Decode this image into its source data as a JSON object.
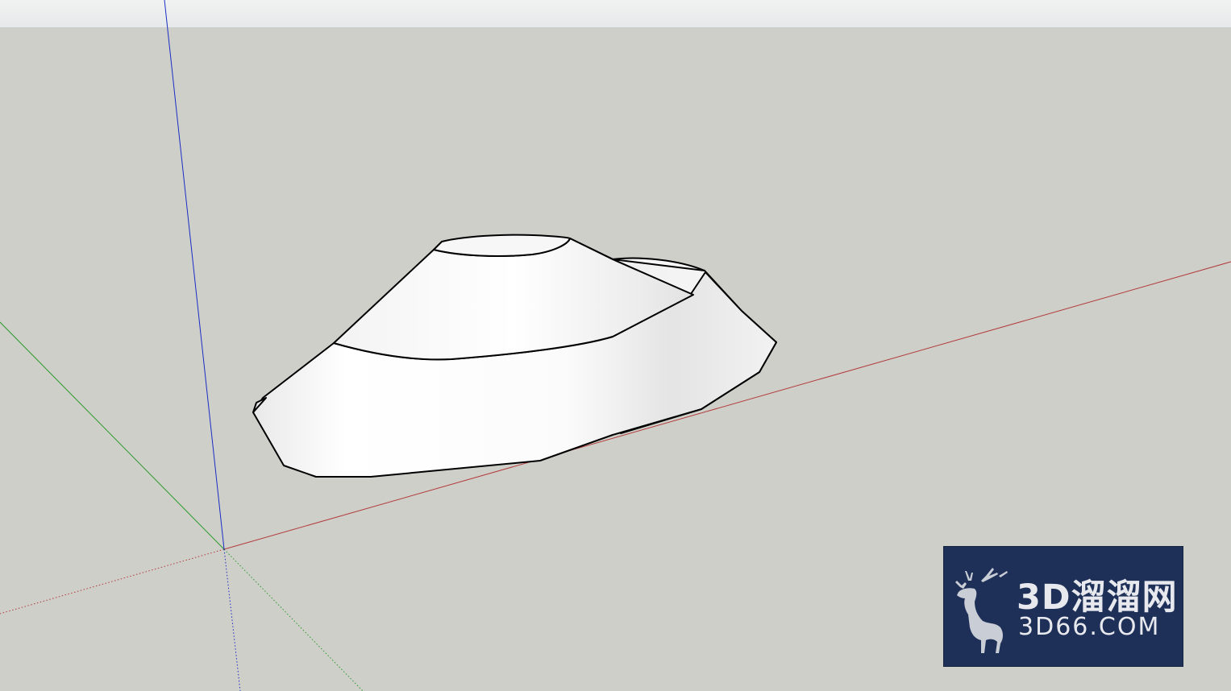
{
  "app": {
    "scene_background": "#cfcfca",
    "top_strip_color": "#eef0f0"
  },
  "axes": {
    "red_axis_color": "#b23a3a",
    "green_axis_color": "#2a9a2a",
    "blue_axis_color": "#1a2cc4"
  },
  "model": {
    "fill_color": "#f4f4f4",
    "edge_color": "#000000"
  },
  "watermark": {
    "brand": "3D溜溜网",
    "site": "3D66.COM",
    "background": "#1f3058",
    "text_color": "#e7e9ee"
  }
}
